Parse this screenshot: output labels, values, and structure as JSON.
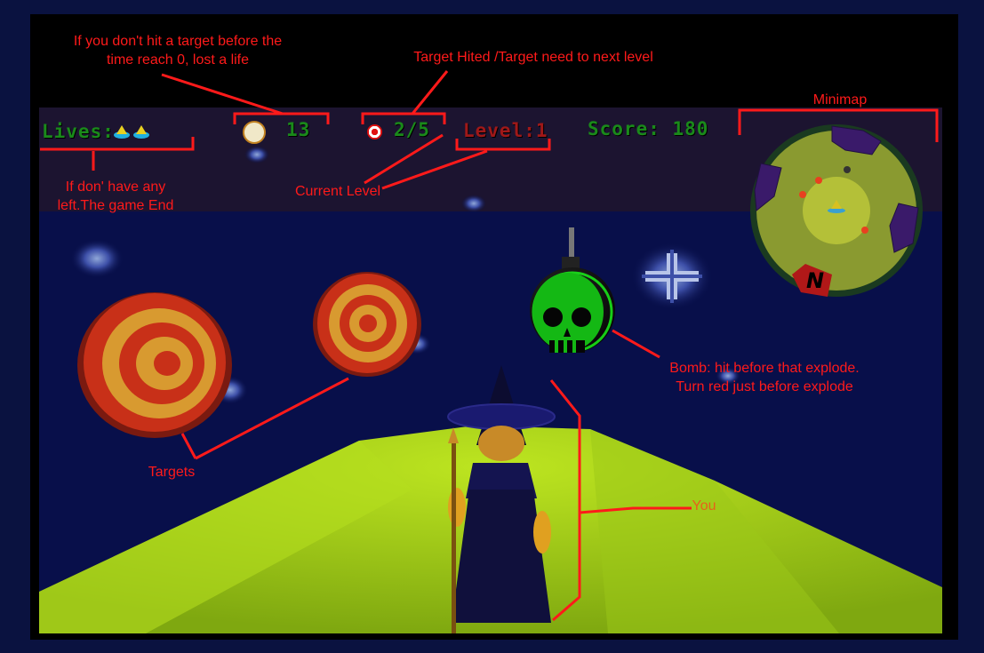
{
  "hud": {
    "lives_label": "Lives:",
    "timer_value": "13",
    "targets_value": "2/5",
    "level_label": "Level:1",
    "score_label": "Score: 180"
  },
  "annotations": {
    "timer_note_line1": "If you don't hit a target before the",
    "timer_note_line2": "time reach 0, lost a life",
    "targets_note": "Target Hited /Target need to next level",
    "minimap_note": "Minimap",
    "lives_note_line1": "If don' have any",
    "lives_note_line2": "left.The game End",
    "level_note": "Current Level",
    "bomb_note_line1": "Bomb: hit before that explode.",
    "bomb_note_line2": "Turn red just before explode",
    "targets_label": "Targets",
    "you_label": "You"
  },
  "minimap": {
    "north_letter": "N"
  },
  "colors": {
    "annotation": "#ff1a1a",
    "hud_text": "#1a8a1a",
    "ground": "#a8d81a",
    "sky": "#080f4a"
  }
}
